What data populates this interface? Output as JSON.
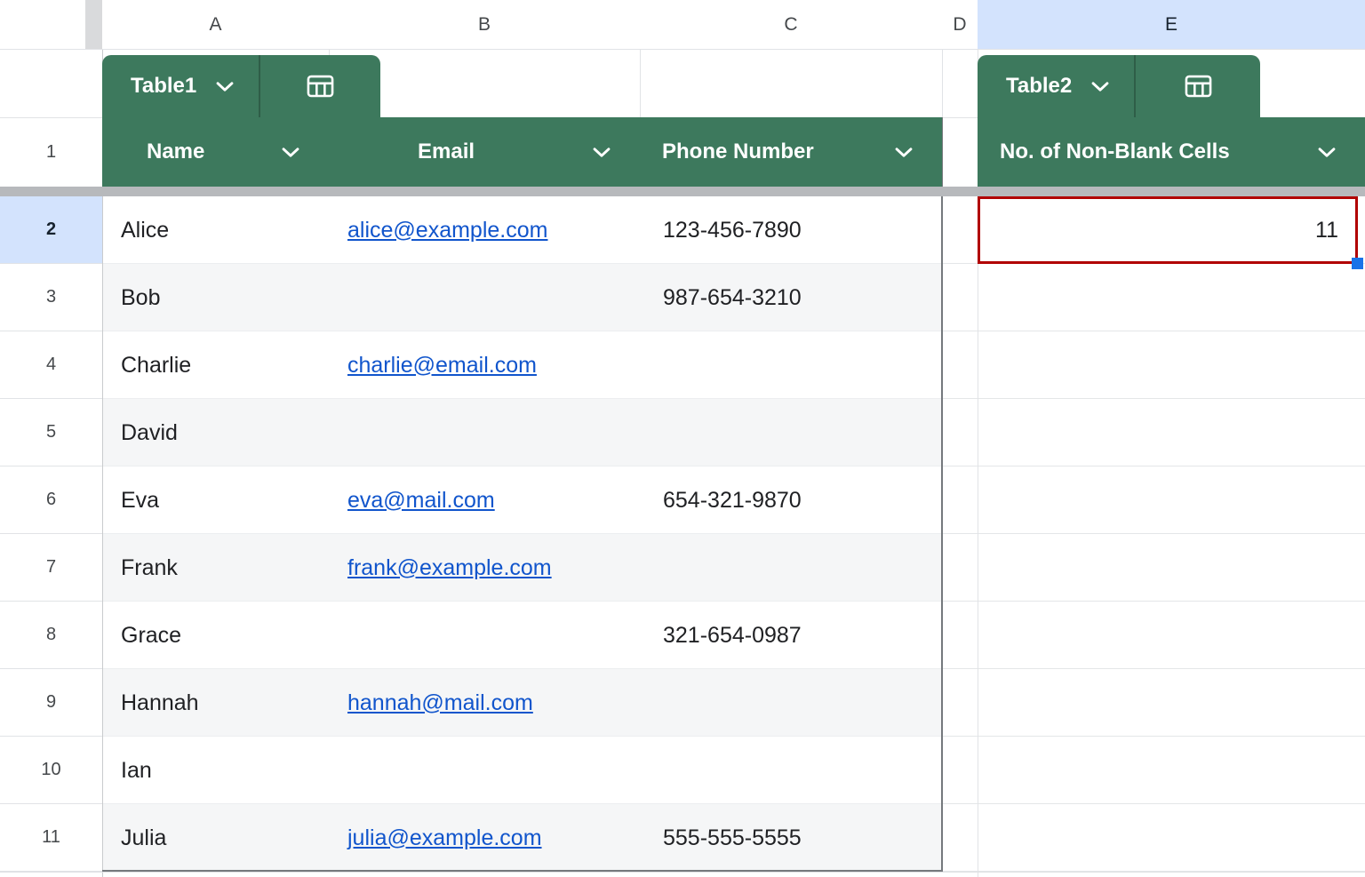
{
  "colors": {
    "table_header_green": "#3d795d",
    "selection_highlight_blue": "#d3e3fd",
    "hyperlink_blue": "#1155cc",
    "annotation_red_border": "#b10202",
    "fill_handle_blue": "#1a73e8",
    "row_band_gray": "#f5f6f7",
    "frozen_divider_gray": "#b7b9bc"
  },
  "column_header_strip": {
    "letters": [
      "A",
      "B",
      "C",
      "D",
      "E"
    ],
    "highlighted_column": "E"
  },
  "row_header": {
    "header_row_number": "1",
    "selected_row_number": "2"
  },
  "table1": {
    "chip_label": "Table1",
    "chip_icon": "table-grid-icon",
    "column_headers": [
      "Name",
      "Email",
      "Phone Number"
    ]
  },
  "table2": {
    "chip_label": "Table2",
    "chip_icon": "table-grid-icon",
    "column_headers": [
      "No. of Non-Blank Cells"
    ],
    "cell_value": "11"
  },
  "data_rows": [
    {
      "row_number": "2",
      "name": "Alice",
      "email": "alice@example.com",
      "phone": "123-456-7890",
      "selected": true
    },
    {
      "row_number": "3",
      "name": "Bob",
      "email": "",
      "phone": "987-654-3210",
      "selected": false
    },
    {
      "row_number": "4",
      "name": "Charlie",
      "email": "charlie@email.com",
      "phone": "",
      "selected": false
    },
    {
      "row_number": "5",
      "name": "David",
      "email": "",
      "phone": "",
      "selected": false
    },
    {
      "row_number": "6",
      "name": "Eva",
      "email": "eva@mail.com",
      "phone": "654-321-9870",
      "selected": false
    },
    {
      "row_number": "7",
      "name": "Frank",
      "email": "frank@example.com",
      "phone": "",
      "selected": false
    },
    {
      "row_number": "8",
      "name": "Grace",
      "email": "",
      "phone": "321-654-0987",
      "selected": false
    },
    {
      "row_number": "9",
      "name": "Hannah",
      "email": "hannah@mail.com",
      "phone": "",
      "selected": false
    },
    {
      "row_number": "10",
      "name": "Ian",
      "email": "",
      "phone": "",
      "selected": false
    },
    {
      "row_number": "11",
      "name": "Julia",
      "email": "julia@example.com",
      "phone": "555-555-5555",
      "selected": false
    }
  ]
}
